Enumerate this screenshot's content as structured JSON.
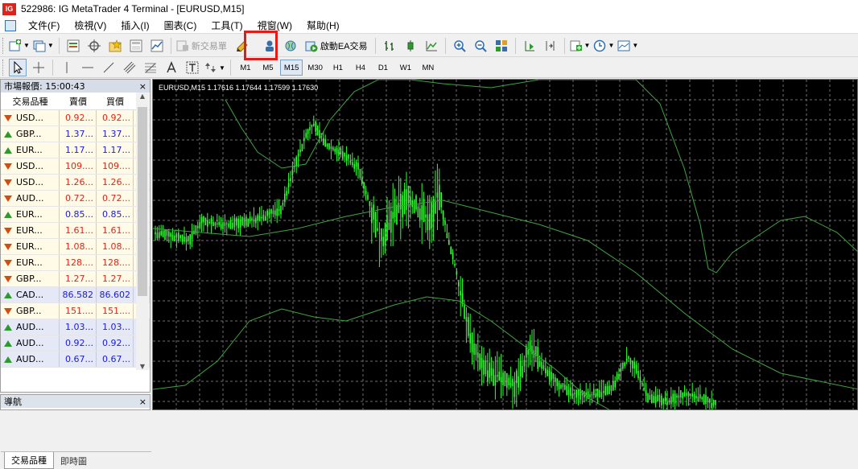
{
  "window": {
    "logo": "IG",
    "title": "522986: IG MetaTrader 4 Terminal - [EURUSD,M15]"
  },
  "menu": [
    "文件(F)",
    "檢視(V)",
    "插入(I)",
    "圖表(C)",
    "工具(T)",
    "視窗(W)",
    "幫助(H)"
  ],
  "toolbar": {
    "new_order": "新交易單",
    "auto_trading": "啟動EA交易"
  },
  "timeframes": [
    "M1",
    "M5",
    "M15",
    "M30",
    "H1",
    "H4",
    "D1",
    "W1",
    "MN"
  ],
  "active_timeframe": "M15",
  "market_watch": {
    "title": "市場報價: 15:00:43",
    "columns": {
      "symbol": "交易品種",
      "bid": "賣價",
      "ask": "買價"
    },
    "rows": [
      {
        "symbol": "USD...",
        "bid": "0.92...",
        "ask": "0.92...",
        "dir": "down",
        "color": "#e2241b"
      },
      {
        "symbol": "GBP...",
        "bid": "1.37...",
        "ask": "1.37...",
        "dir": "up",
        "color": "#1a1ae0"
      },
      {
        "symbol": "EUR...",
        "bid": "1.17...",
        "ask": "1.17...",
        "dir": "up",
        "color": "#1a1ae0"
      },
      {
        "symbol": "USD...",
        "bid": "109....",
        "ask": "109....",
        "dir": "down",
        "color": "#e2241b"
      },
      {
        "symbol": "USD...",
        "bid": "1.26...",
        "ask": "1.26...",
        "dir": "down",
        "color": "#e2241b"
      },
      {
        "symbol": "AUD...",
        "bid": "0.72...",
        "ask": "0.72...",
        "dir": "down",
        "color": "#e2241b"
      },
      {
        "symbol": "EUR...",
        "bid": "0.85...",
        "ask": "0.85...",
        "dir": "up",
        "color": "#1a1ae0"
      },
      {
        "symbol": "EUR...",
        "bid": "1.61...",
        "ask": "1.61...",
        "dir": "down",
        "color": "#e2241b"
      },
      {
        "symbol": "EUR...",
        "bid": "1.08...",
        "ask": "1.08...",
        "dir": "down",
        "color": "#e2241b"
      },
      {
        "symbol": "EUR...",
        "bid": "128....",
        "ask": "128....",
        "dir": "down",
        "color": "#e2241b"
      },
      {
        "symbol": "GBP...",
        "bid": "1.27...",
        "ask": "1.27...",
        "dir": "down",
        "color": "#e2241b"
      },
      {
        "symbol": "CAD...",
        "bid": "86.582",
        "ask": "86.602",
        "dir": "up",
        "color": "#1a1ae0"
      },
      {
        "symbol": "GBP...",
        "bid": "151....",
        "ask": "151....",
        "dir": "down",
        "color": "#e2241b"
      },
      {
        "symbol": "AUD...",
        "bid": "1.03...",
        "ask": "1.03...",
        "dir": "up",
        "color": "#1a1ae0"
      },
      {
        "symbol": "AUD...",
        "bid": "0.92...",
        "ask": "0.92...",
        "dir": "up",
        "color": "#1a1ae0"
      },
      {
        "symbol": "AUD...",
        "bid": "0.67...",
        "ask": "0.67...",
        "dir": "up",
        "color": "#1a1ae0"
      }
    ],
    "tabs": [
      "交易品種",
      "即時圖"
    ]
  },
  "navigator": {
    "title": "導航"
  },
  "chart": {
    "symbol_info": "EURUSD,M15  1.17616 1.17644 1.17599 1.17630"
  }
}
